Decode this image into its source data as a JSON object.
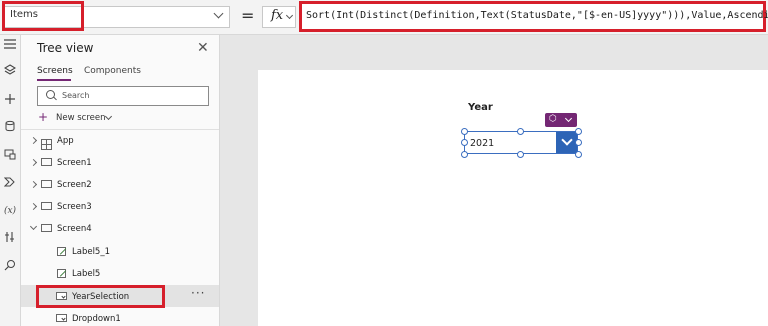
{
  "formula_bar": {
    "property": "Items",
    "equals": "=",
    "fx": "fx",
    "formula": "Sort(Int(Distinct(Definition,Text(StatusDate,\"[$-en-US]yyyy\"))),Value,Ascending)"
  },
  "rail": {
    "icons": [
      "hamburger-icon",
      "layers-icon",
      "plus-icon",
      "database-icon",
      "media-icon",
      "power-automate-icon",
      "variables-icon",
      "advanced-tools-icon",
      "search-icon"
    ],
    "variables_glyph": "(x)"
  },
  "tree": {
    "title": "Tree view",
    "close": "✕",
    "tabs": [
      "Screens",
      "Components"
    ],
    "search_placeholder": "Search",
    "new_screen": "New screen",
    "rows": [
      "App",
      "Screen1",
      "Screen2",
      "Screen3",
      "Screen4",
      "Label5_1",
      "Label5",
      "YearSelection",
      "Dropdown1"
    ],
    "more": "···"
  },
  "canvas": {
    "year_label": "Year",
    "dropdown_value": "2021"
  },
  "colors": {
    "highlight": "#d61f2b",
    "accent": "#742774",
    "dropdown_button": "#2d64b6"
  }
}
